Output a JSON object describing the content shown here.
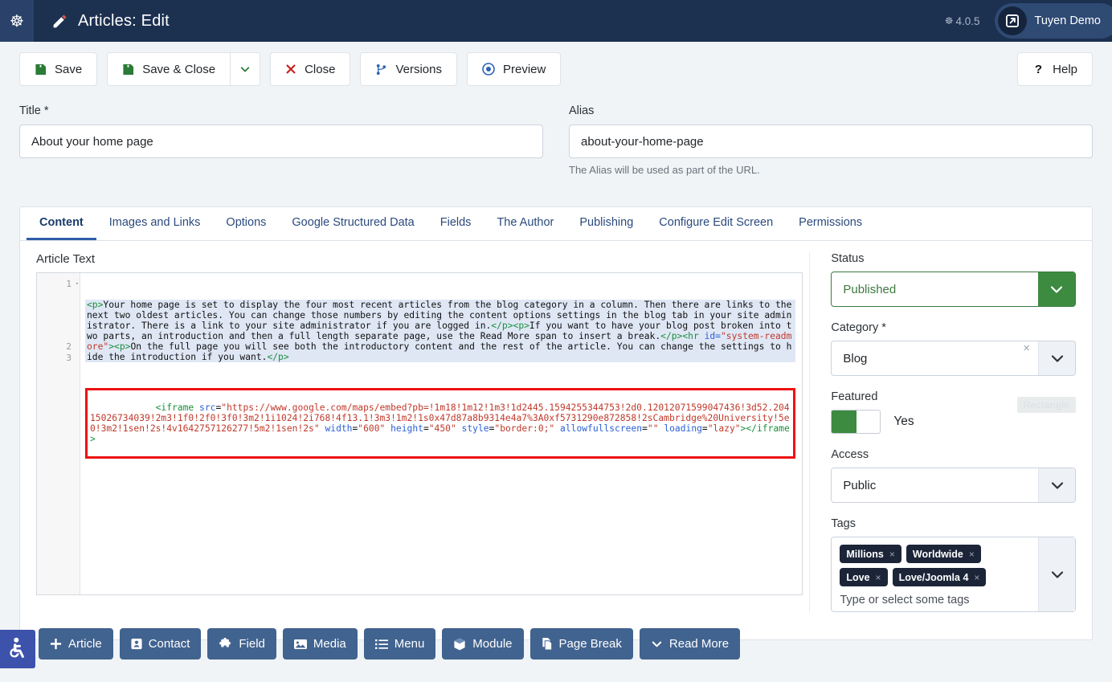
{
  "topbar": {
    "joomla_icon": "joomla-logo-icon",
    "edit_icon": "pencil-icon",
    "title": "Articles: Edit",
    "version": "4.0.5",
    "version_icon": "joomla-mark-icon",
    "user_name": "Tuyen Demo",
    "user_icon": "external-link-icon"
  },
  "toolbar": {
    "save_label": "Save",
    "save_icon": "floppy-disk-icon",
    "save_close_label": "Save & Close",
    "save_close_icon": "floppy-disk-icon",
    "dropdown_icon": "chevron-down-icon",
    "close_label": "Close",
    "close_icon": "x-icon",
    "versions_label": "Versions",
    "versions_icon": "code-branch-icon",
    "preview_label": "Preview",
    "preview_icon": "eye-icon",
    "help_label": "Help",
    "help_icon": "question-mark-icon"
  },
  "fields": {
    "title_label": "Title *",
    "title_value": "About your home page",
    "title_placeholder": "",
    "alias_label": "Alias",
    "alias_value": "about-your-home-page",
    "alias_placeholder": "",
    "alias_hint": "The Alias will be used as part of the URL."
  },
  "tabs": [
    {
      "label": "Content",
      "active": true
    },
    {
      "label": "Images and Links",
      "active": false
    },
    {
      "label": "Options",
      "active": false
    },
    {
      "label": "Google Structured Data",
      "active": false
    },
    {
      "label": "Fields",
      "active": false
    },
    {
      "label": "The Author",
      "active": false
    },
    {
      "label": "Publishing",
      "active": false
    },
    {
      "label": "Configure Edit Screen",
      "active": false
    },
    {
      "label": "Permissions",
      "active": false
    }
  ],
  "editor": {
    "label": "Article Text",
    "line_numbers": [
      "1",
      "2",
      "3"
    ],
    "fold_marker": "▾",
    "code_line1_segments": [
      {
        "type": "tag",
        "text": "<p>"
      },
      {
        "type": "txt",
        "text": "Your home page is set to display the four most recent articles from the blog category in a column. Then there are links to the next two oldest articles. You can change those numbers by editing the content options settings in the blog tab in your site administrator. There is a link to your site administrator if you are logged in."
      },
      {
        "type": "tag",
        "text": "</p>"
      },
      {
        "type": "tag",
        "text": "<p>"
      },
      {
        "type": "txt",
        "text": "If you want to have your blog post broken into two parts, an introduction and then a full length separate page, use the Read More span to insert a break."
      },
      {
        "type": "tag",
        "text": "</p>"
      },
      {
        "type": "tag",
        "text": "<hr "
      },
      {
        "type": "attr",
        "text": "id="
      },
      {
        "type": "val",
        "text": "\"system-readmore\""
      },
      {
        "type": "tag",
        "text": ">"
      },
      {
        "type": "tag",
        "text": "<p>"
      },
      {
        "type": "txt",
        "text": "On the full page you will see both the introductory content and the rest of the article. You can change the settings to hide the introduction if you want."
      },
      {
        "type": "tag",
        "text": "</p>"
      }
    ],
    "iframe_code": "<iframe src=\"https://www.google.com/maps/embed?pb=!1m18!1m12!1m3!1d2445.1594255344753!2d0.12012071599047436!3d52.20415026734039!2m3!1f0!2f0!3f0!3m2!1i1024!2i768!4f13.1!3m3!1m2!1s0x47d87a8b9314e4a7%3A0xf5731290e872858!2sCambridge%20University!5e0!3m2!1sen!2s!4v1642757126277!5m2!1sen!2s\" width=\"600\" height=\"450\" style=\"border:0;\" allowfullscreen=\"\" loading=\"lazy\"></iframe>",
    "highlight_color": "#ee1111"
  },
  "sidebar": {
    "status_label": "Status",
    "status_value": "Published",
    "status_color": "#3d8b40",
    "status_arrow_icon": "chevron-down-icon",
    "category_label": "Category *",
    "category_value": "Blog",
    "category_clear_icon": "x-icon",
    "category_arrow_icon": "chevron-down-icon",
    "featured_label": "Featured",
    "featured_value": "Yes",
    "featured_toggle_icon": "toggle-switch-icon",
    "access_label": "Access",
    "access_value": "Public",
    "access_arrow_icon": "chevron-down-icon",
    "tags_label": "Tags",
    "tags": [
      "Millions",
      "Worldwide",
      "Love",
      "Love/Joomla 4"
    ],
    "tags_remove_icon": "x-icon",
    "tags_placeholder": "Type or select some tags",
    "tags_arrow_icon": "chevron-down-icon",
    "watermark": "Rectangle"
  },
  "bottom_buttons": [
    {
      "label": "Article",
      "icon": "plus-icon"
    },
    {
      "label": "Contact",
      "icon": "address-card-icon"
    },
    {
      "label": "Field",
      "icon": "puzzle-piece-icon"
    },
    {
      "label": "Media",
      "icon": "image-icon"
    },
    {
      "label": "Menu",
      "icon": "list-icon"
    },
    {
      "label": "Module",
      "icon": "cube-icon"
    },
    {
      "label": "Page Break",
      "icon": "copy-icon"
    },
    {
      "label": "Read More",
      "icon": "chevron-down-icon"
    }
  ],
  "accessibility": {
    "icon": "wheelchair-accessibility-icon",
    "color": "#3c52ab"
  }
}
